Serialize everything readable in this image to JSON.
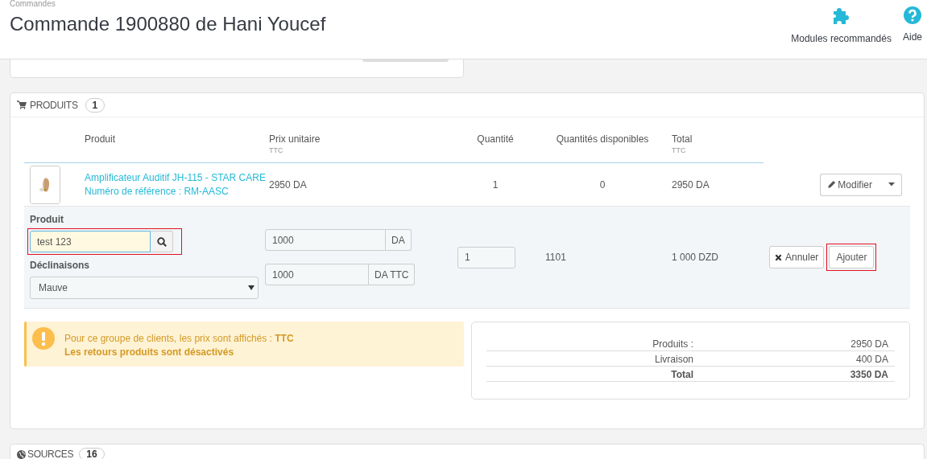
{
  "breadcrumb": "Commandes",
  "title": "Commande 1900880 de Hani Youcef",
  "toolbar": [
    {
      "label": "Modules recommandés",
      "kind": "puzzle"
    },
    {
      "label": "Aide",
      "kind": "help"
    }
  ],
  "products_panel": {
    "heading": "PRODUITS",
    "count": "1",
    "columns": [
      {
        "label": "Produit"
      },
      {
        "label": "Prix unitaire",
        "sub": "TTC"
      },
      {
        "label": "Quantité"
      },
      {
        "label": "Quantités disponibles"
      },
      {
        "label": "Total",
        "sub": "TTC"
      }
    ],
    "rows": [
      {
        "name": "Amplificateur Auditif JH-115 - STAR CARE",
        "reference": "Numéro de référence : RM-AASC",
        "price": "2950 DA",
        "quantity": "1",
        "available": "0",
        "total": "2950 DA",
        "action": "Modifier"
      }
    ],
    "add_form": {
      "product_label": "Produit",
      "product_value": "test 123",
      "product_search_highlighted": true,
      "variant_label": "Déclinaisons",
      "variant_value": "Mauve",
      "price_excl": "1000",
      "price_excl_unit": "DA",
      "price_incl": "1000",
      "price_incl_unit": "DA TTC",
      "quantity": "1",
      "available": "1101",
      "total": "1 000 DZD",
      "cancel": "Annuler",
      "add": "Ajouter",
      "add_highlighted": true
    }
  },
  "alert": {
    "lines": [
      {
        "text": "Pour ce groupe de clients, les prix sont affichés : **TTC**",
        "bold": false
      },
      {
        "text": "Les retours produits sont désactivés",
        "bold": true
      }
    ]
  },
  "totals": [
    {
      "label": "Produits :",
      "value": "2950 DA",
      "bold": false
    },
    {
      "label": "Livraison",
      "value": "400 DA",
      "bold": false
    },
    {
      "label": "Total",
      "value": "3350 DA",
      "bold": true
    }
  ],
  "sources_panel": {
    "heading": "SOURCES",
    "count": "16"
  }
}
